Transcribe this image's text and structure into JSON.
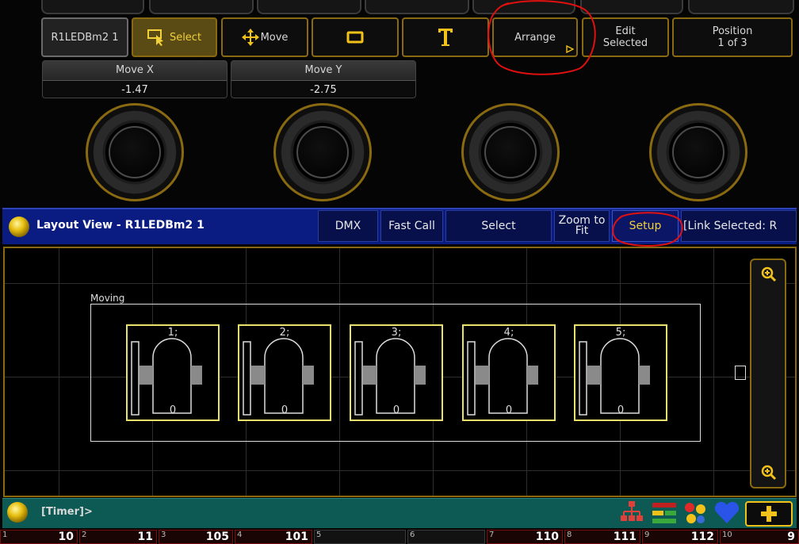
{
  "toolbar": {
    "fixture_label": "R1LEDBm2 1",
    "select_label": "Select",
    "move_label": "Move",
    "arrange_label": "Arrange",
    "edit_selected_label": "Edit\nSelected",
    "position_label": "Position\n1 of 3"
  },
  "encoders": [
    {
      "label": "Move X",
      "value": "-1.47"
    },
    {
      "label": "Move Y",
      "value": "-2.75"
    }
  ],
  "window": {
    "title": "Layout View - R1LEDBm2 1",
    "buttons": {
      "dmx": "DMX",
      "fast_call": "Fast Call",
      "select": "Select",
      "zoom_to_fit": "Zoom to\nFit",
      "setup": "Setup",
      "link_selected": "[Link Selected: R"
    }
  },
  "layout": {
    "group_label": "Moving",
    "fixtures": [
      {
        "id": "1;",
        "value": "0"
      },
      {
        "id": "2;",
        "value": "0"
      },
      {
        "id": "3;",
        "value": "0"
      },
      {
        "id": "4;",
        "value": "0"
      },
      {
        "id": "5;",
        "value": "0"
      }
    ]
  },
  "status": {
    "timer_text": "[Timer]>"
  },
  "executors": [
    {
      "n": "1",
      "v": "10"
    },
    {
      "n": "2",
      "v": "11"
    },
    {
      "n": "3",
      "v": "105"
    },
    {
      "n": "4",
      "v": "101"
    },
    {
      "n": "5",
      "v": ""
    },
    {
      "n": "6",
      "v": ""
    },
    {
      "n": "7",
      "v": "110"
    },
    {
      "n": "8",
      "v": "111"
    },
    {
      "n": "9",
      "v": "112"
    },
    {
      "n": "10",
      "v": "9"
    }
  ],
  "colors": {
    "accent_gold": "#8a6a10",
    "title_blue": "#0a1c82",
    "status_teal": "#0d5a55",
    "fixture_yellow": "#e9e16a",
    "annotation_red": "#e01010"
  },
  "icons": [
    "select-cursor-icon",
    "move-arrows-icon",
    "rectangle-icon",
    "text-icon",
    "zoom-in-icon",
    "zoom-out-icon",
    "network-icon",
    "dmx-icon",
    "dots-icon",
    "heart-icon",
    "plus-icon",
    "status-ball-icon"
  ]
}
